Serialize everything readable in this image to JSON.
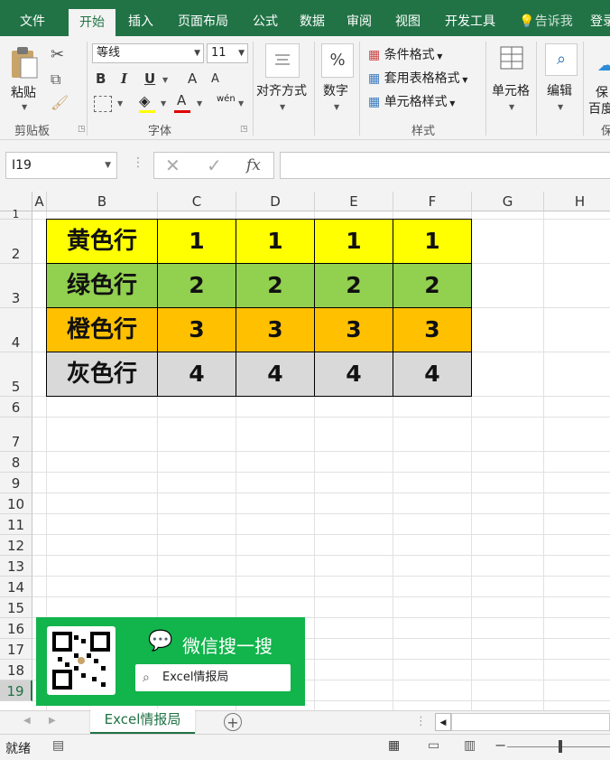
{
  "ribbon_tabs": [
    "文件",
    "开始",
    "插入",
    "页面布局",
    "公式",
    "数据",
    "审阅",
    "视图",
    "开发工具"
  ],
  "active_tab": "开始",
  "tell_me": "告诉我",
  "signin": "登录",
  "clipboard": {
    "paste": "粘贴",
    "group": "剪贴板"
  },
  "font": {
    "name": "等线",
    "size": "11",
    "group": "字体",
    "bold": "B",
    "italic": "I",
    "underline": "U",
    "grow": "A",
    "shrink": "A",
    "font_color": "A",
    "phonetic": "wén"
  },
  "alignment": {
    "label": "对齐方式"
  },
  "number": {
    "label": "数字",
    "icon_text": "%"
  },
  "styles": {
    "conditional": "条件格式",
    "table": "套用表格格式",
    "cell_styles": "单元格样式",
    "group": "样式"
  },
  "cells": {
    "label": "单元格"
  },
  "editing": {
    "label": "编辑"
  },
  "extra": {
    "label1": "保",
    "label2": "百度",
    "group": "保"
  },
  "namebox": "I19",
  "fx": "fx",
  "columns": [
    "A",
    "B",
    "C",
    "D",
    "E",
    "F",
    "G",
    "H"
  ],
  "rows": [
    "1",
    "2",
    "3",
    "4",
    "5",
    "6",
    "7",
    "8",
    "9",
    "10",
    "11",
    "12",
    "13",
    "14",
    "15",
    "16",
    "17",
    "18",
    "19"
  ],
  "table": [
    {
      "label": "黄色行",
      "values": [
        "1",
        "1",
        "1",
        "1"
      ],
      "color": "#FFFF00"
    },
    {
      "label": "绿色行",
      "values": [
        "2",
        "2",
        "2",
        "2"
      ],
      "color": "#92D050"
    },
    {
      "label": "橙色行",
      "values": [
        "3",
        "3",
        "3",
        "3"
      ],
      "color": "#FFC000"
    },
    {
      "label": "灰色行",
      "values": [
        "4",
        "4",
        "4",
        "4"
      ],
      "color": "#D9D9D9"
    }
  ],
  "ad": {
    "title": "微信搜一搜",
    "search": "Excel情报局"
  },
  "sheet_tab": "Excel情报局",
  "status": "就绪",
  "colors": {
    "accent": "#217346",
    "ad_green": "#12B44C"
  }
}
